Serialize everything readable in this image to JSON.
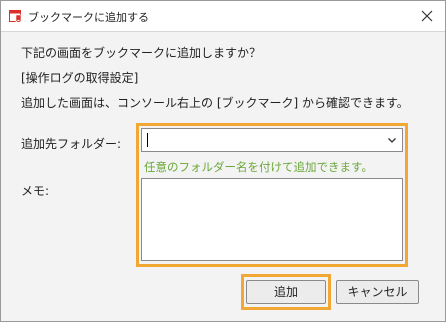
{
  "window": {
    "title": "ブックマークに追加する",
    "icon": "bookmark-add-icon",
    "close_icon": "close-icon"
  },
  "message": {
    "question": "下記の画面をブックマークに追加しますか？",
    "screen_name": "[操作ログの取得設定]",
    "info": "追加した画面は、コンソール右上の [ブックマーク] から確認できます。"
  },
  "form": {
    "folder_label": "追加先フォルダー:",
    "folder_value": "",
    "folder_hint": "任意のフォルダー名を付けて追加できます。",
    "memo_label": "メモ:",
    "memo_value": ""
  },
  "buttons": {
    "add_label": "追加",
    "cancel_label": "キャンセル"
  },
  "colors": {
    "highlight": "#f0a832",
    "hint_text": "#6ba83b",
    "icon_red": "#d9302c"
  }
}
